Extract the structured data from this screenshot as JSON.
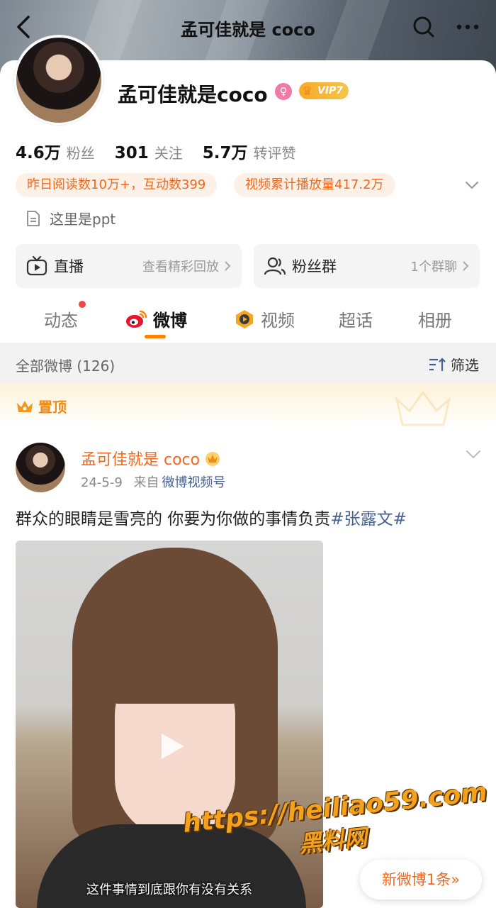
{
  "nav": {
    "title": "孟可佳就是 coco"
  },
  "profile": {
    "name": "孟可佳就是coco",
    "vip_label": "VIP7",
    "stats": [
      {
        "value": "4.6万",
        "label": "粉丝"
      },
      {
        "value": "301",
        "label": "关注"
      },
      {
        "value": "5.7万",
        "label": "转评赞"
      }
    ],
    "pills": [
      "昨日阅读数10万+，互动数399",
      "视频累计播放量417.2万"
    ],
    "description": "这里是ppt"
  },
  "features": {
    "live": {
      "title": "直播",
      "sub": "查看精彩回放"
    },
    "fans_group": {
      "title": "粉丝群",
      "sub": "1个群聊"
    }
  },
  "tabs": [
    "动态",
    "微博",
    "视频",
    "超话",
    "相册"
  ],
  "filter_bar": {
    "count_label": "全部微博 (126)",
    "filter_label": "筛选"
  },
  "pinned_label": "置顶",
  "post": {
    "author": "孟可佳就是 coco",
    "date": "24-5-9",
    "from_prefix": "来自",
    "source": "微博视频号",
    "text": "群众的眼睛是雪亮的 你要为你做的事情负责",
    "topic": "#张露文#",
    "video_caption": "这件事情到底跟你有没有关系"
  },
  "watermark": {
    "url": "https://heiliao59.com",
    "site": "黑料网"
  },
  "new_post_button": "新微博1条",
  "colors": {
    "accent": "#ff8200",
    "link": "#47608f",
    "orange_text": "#f0691e"
  }
}
